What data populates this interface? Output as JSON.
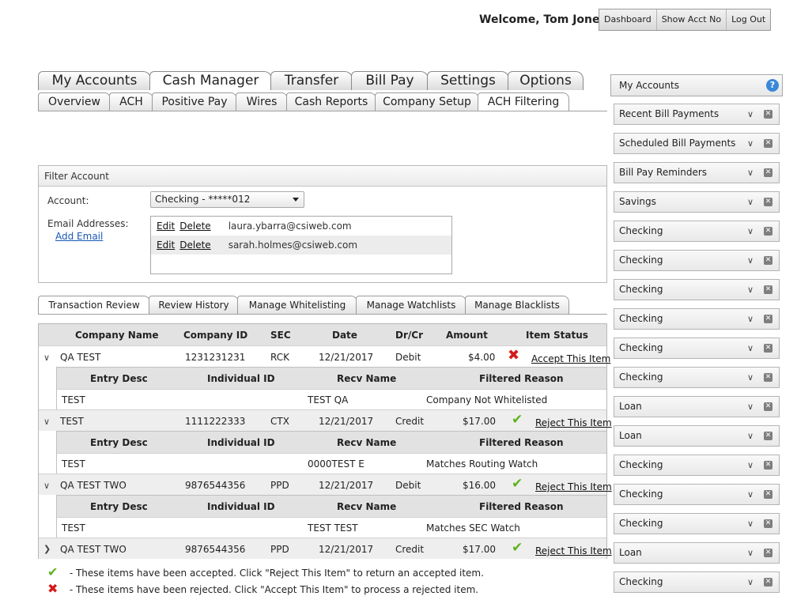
{
  "header": {
    "welcome": "Welcome, Tom Jones",
    "buttons": [
      "Dashboard",
      "Show Acct No",
      "Log Out"
    ]
  },
  "main_tabs": [
    "My Accounts",
    "Cash Manager",
    "Transfer",
    "Bill Pay",
    "Settings",
    "Options"
  ],
  "main_tabs_active": "Cash Manager",
  "sub_tabs": [
    "Overview",
    "ACH",
    "Positive Pay",
    "Wires",
    "Cash Reports",
    "Company Setup",
    "ACH Filtering"
  ],
  "sub_tabs_active": "ACH Filtering",
  "filter": {
    "title": "Filter Account",
    "account_label": "Account:",
    "account_value": "Checking - *****012",
    "email_label": "Email Addresses:",
    "add_email": "Add Email",
    "edit": "Edit",
    "delete": "Delete",
    "emails": [
      "laura.ybarra@csiweb.com",
      "sarah.holmes@csiweb.com"
    ]
  },
  "review_tabs": [
    "Transaction Review",
    "Review History",
    "Manage Whitelisting",
    "Manage Watchlists",
    "Manage Blacklists"
  ],
  "review_tabs_active": "Transaction Review",
  "table": {
    "columns": [
      "Company Name",
      "Company ID",
      "SEC",
      "Date",
      "Dr/Cr",
      "Amount",
      "Item Status"
    ],
    "sub_columns": [
      "Entry Desc",
      "Individual ID",
      "Recv Name",
      "Filtered Reason"
    ],
    "rows": [
      {
        "company": "QA TEST",
        "id": "1231231231",
        "sec": "RCK",
        "date": "12/21/2017",
        "drcr": "Debit",
        "amount": "$4.00",
        "status": "rejected",
        "action": "Accept This Item",
        "expanded": true,
        "detail": {
          "entry_desc": "TEST",
          "individual_id": "",
          "recv_name": "TEST QA",
          "reason": "Company Not Whitelisted"
        }
      },
      {
        "company": "TEST",
        "id": "1111222333",
        "sec": "CTX",
        "date": "12/21/2017",
        "drcr": "Credit",
        "amount": "$17.00",
        "status": "accepted",
        "action": "Reject This Item",
        "expanded": true,
        "detail": {
          "entry_desc": "TEST",
          "individual_id": "",
          "recv_name": "0000TEST E",
          "reason": "Matches Routing Watch"
        }
      },
      {
        "company": "QA TEST TWO",
        "id": "9876544356",
        "sec": "PPD",
        "date": "12/21/2017",
        "drcr": "Debit",
        "amount": "$16.00",
        "status": "accepted",
        "action": "Reject This Item",
        "expanded": true,
        "detail": {
          "entry_desc": "TEST",
          "individual_id": "",
          "recv_name": "TEST TEST",
          "reason": "Matches SEC Watch"
        }
      },
      {
        "company": "QA TEST TWO",
        "id": "9876544356",
        "sec": "PPD",
        "date": "12/21/2017",
        "drcr": "Credit",
        "amount": "$17.00",
        "status": "accepted",
        "action": "Reject This Item",
        "expanded": false
      }
    ]
  },
  "legend": {
    "accepted": "- These items have been accepted. Click \"Reject This Item\" to return an accepted item.",
    "rejected": "- These items have been rejected. Click \"Accept This Item\" to process a rejected item."
  },
  "sidebar": {
    "title": "My Accounts",
    "help": "?",
    "items": [
      "Recent Bill Payments",
      "Scheduled Bill Payments",
      "Bill Pay Reminders",
      "Savings",
      "Checking",
      "Checking",
      "Checking",
      "Checking",
      "Checking",
      "Checking",
      "Loan",
      "Loan",
      "Checking",
      "Checking",
      "Checking",
      "Loan",
      "Checking"
    ]
  },
  "colors": {
    "accept_icon": "#5fb31f",
    "reject_icon": "#d41a1a",
    "link": "#1a56b6"
  }
}
